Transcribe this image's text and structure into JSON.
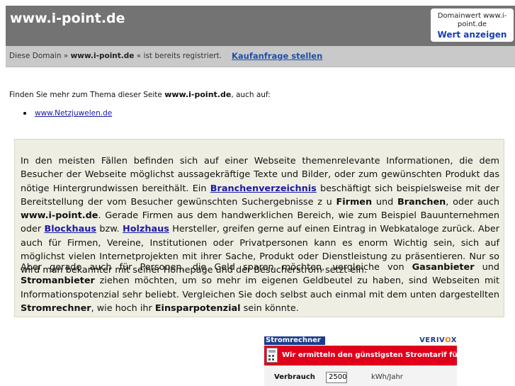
{
  "header": {
    "title": "www.i-point.de",
    "domainwert_label": "Domainwert www.i-point.de",
    "wert_link": "Wert anzeigen"
  },
  "subbar": {
    "prefix": "Diese Domain »",
    "domain": "www.i-point.de",
    "suffix": "« ist bereits registriert.",
    "kauf_link": "Kaufanfrage stellen"
  },
  "finden": {
    "prefix": "Finden Sie mehr zum Thema dieser Seite",
    "domain": "www.i-point.de",
    "suffix": ", auch auf:"
  },
  "links": [
    "www.Netzjuwelen.de"
  ],
  "content": {
    "p1": {
      "t1": "In den meisten Fällen befinden sich auf einer Webseite themenrelevante Informationen, die dem Besucher der Webseite möglichst aussagekräftige Texte und Bilder, oder zum gewünschten Produkt das nötige Hintergrundwissen bereithält. Ein ",
      "link1": "Branchenverzeichnis",
      "t2": " beschäftigt sich beispielsweise mit der Bereitstellung der vom Besucher gewünschten Suchergebnisse z u ",
      "b1": "Firmen",
      "t3": "  und ",
      "b2": "Branchen",
      "t4": ", oder auch ",
      "b3": "www.i-point.de",
      "t5": ". Gerade Firmen aus dem handwerklichen Bereich, wie zum Beispiel Bauunternehmen oder ",
      "link2": "Blockhaus",
      "t6": " bzw. ",
      "link3": "Holzhaus",
      "t7": " Hersteller, greifen gerne auf einen Eintrag in Webkataloge zurück. Aber auch für Firmen, Vereine, Institutionen oder Privatpersonen kann es enorm Wichtig sein, sich auf möglichst vielen Internetprojekten mit ihrer Sache, Produkt oder Dienstleistung zu präsentieren. Nur so wird man bekannter mit seiner Homepage und der Besucherstrom setzt ein."
    },
    "p2": {
      "t1": "Aber gerade auch für Personen, die Geld sparen möchten, vergleiche von ",
      "b1": "Gasanbieter",
      "t2": " und ",
      "b2": "Stromanbieter",
      "t3": " ziehen möchten, um so mehr im eigenen Geldbeutel zu haben, sind Webseiten mit Informationspotenzial sehr beliebt. Vergleichen Sie doch selbst auch einmal mit dem unten dargestellten ",
      "b3": "Stromrechner",
      "t4": ", wie hoch ihr ",
      "b4": "Einsparpotenzial",
      "t5": " sein könnte."
    }
  },
  "widget": {
    "tab": "Stromrechner",
    "brand_a": "VERIV",
    "brand_x": "O",
    "brand_b": "X",
    "banner": "Wir ermitteln den günstigsten Stromtarif für Sie!",
    "label": "Verbrauch",
    "value": "2500",
    "unit": "kWh/Jahr",
    "colors": {
      "tab": "#1c3c8c",
      "banner": "#e0001b"
    }
  }
}
